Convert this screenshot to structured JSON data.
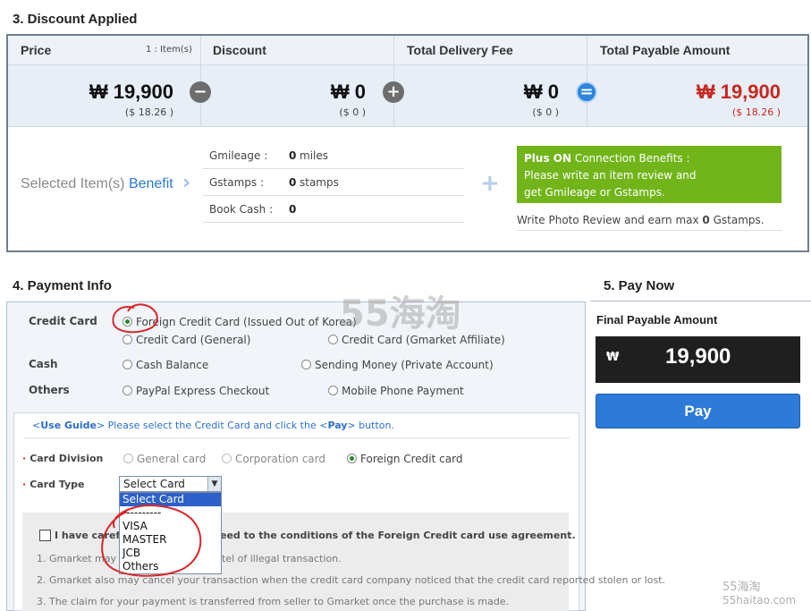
{
  "discount_section": {
    "title": "3. Discount Applied",
    "headers": {
      "price": "Price",
      "item_count": "1 : Item(s)",
      "discount": "Discount",
      "delivery": "Total Delivery Fee",
      "total": "Total Payable Amount"
    },
    "amounts": {
      "price": "₩ 19,900",
      "price_usd": "($ 18.26 )",
      "discount": "₩ 0",
      "discount_usd": "($ 0 )",
      "delivery": "₩ 0",
      "delivery_usd": "($ 0 )",
      "total": "₩ 19,900",
      "total_usd": "($ 18.26 )"
    },
    "operators": {
      "minus": "−",
      "plus": "+",
      "equals": "="
    },
    "benefit": {
      "label_plain": "Selected Item(s) ",
      "label_accent": "Benefit",
      "rows": [
        {
          "name": "Gmileage :",
          "value": "0",
          "unit": "miles"
        },
        {
          "name": "Gstamps :",
          "value": "0",
          "unit": "stamps"
        },
        {
          "name": "Book Cash :",
          "value": "0",
          "unit": ""
        }
      ],
      "plus_on_bold": "Plus ON",
      "plus_on_rest": " Connection Benefits :",
      "plus_on_line2": "Please write an item review and",
      "plus_on_line3": "get Gmileage or Gstamps.",
      "photo_review_pre": "Write Photo Review and earn max ",
      "photo_review_num": "0",
      "photo_review_post": " Gstamps."
    },
    "colors": {
      "total_red": "#c8281e",
      "green_box": "#71b51a"
    }
  },
  "payment_section": {
    "title": "4. Payment Info",
    "groups": {
      "credit_card": "Credit Card",
      "cash": "Cash",
      "others": "Others"
    },
    "options": {
      "foreign_credit_card": "Foreign Credit Card (Issued Out of Korea)",
      "credit_card_general": "Credit Card (General)",
      "credit_card_gmarket": "Credit Card (Gmarket Affiliate)",
      "cash_balance": "Cash Balance",
      "sending_money": "Sending Money (Private Account)",
      "paypal": "PayPal Express Checkout",
      "mobile_phone": "Mobile Phone Payment"
    },
    "guide": {
      "open_bracket": "<",
      "use_guide": "Use Guide",
      "mid": "> Please select the Credit Card and click the <",
      "pay": "Pay",
      "end": "> button."
    },
    "card_division": {
      "label": "Card Division",
      "options": [
        "General card",
        "Corporation card",
        "Foreign Credit card"
      ],
      "selected": "Foreign Credit card"
    },
    "card_type": {
      "label": "Card Type",
      "selected": "Select Card",
      "options": [
        "Select Card",
        "----------",
        "VISA",
        "MASTER",
        "JCB",
        "Others"
      ]
    },
    "agreement": {
      "text_left": "I have carefu",
      "text_right": "eed to the conditions of the Foreign Credit card use agreement.",
      "notes": [
        "1. Gmarket may te",
        "tel of illegal transaction.",
        "2. Gmarket also may cancel your transaction when the credit card company noticed that the credit card reported stolen or lost.",
        "3. The claim for your payment is transferred from seller to Gmarket once the purchase is made."
      ]
    }
  },
  "pay_now_section": {
    "title": "5. Pay Now",
    "final_label": "Final Payable Amount",
    "currency": "₩",
    "final_amount": "19,900",
    "pay_button": "Pay"
  },
  "watermarks": {
    "center": "55海淘",
    "corner_top": "55海淘",
    "corner_bottom": "55haitao.com"
  }
}
